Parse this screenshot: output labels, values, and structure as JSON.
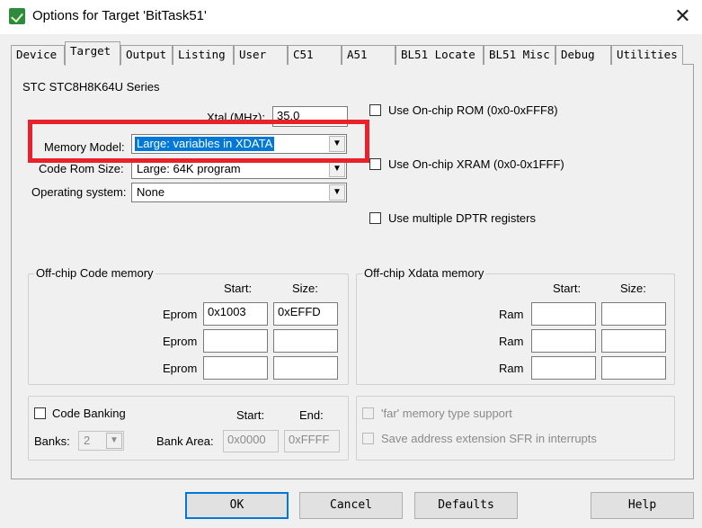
{
  "window": {
    "title": "Options for Target 'BitTask51'",
    "close_glyph": "✕"
  },
  "tabs": [
    {
      "label": "Device"
    },
    {
      "label": "Target"
    },
    {
      "label": "Output"
    },
    {
      "label": "Listing"
    },
    {
      "label": "User"
    },
    {
      "label": "C51"
    },
    {
      "label": "A51"
    },
    {
      "label": "BL51 Locate"
    },
    {
      "label": "BL51 Misc"
    },
    {
      "label": "Debug"
    },
    {
      "label": "Utilities"
    }
  ],
  "device_name": "STC STC8H8K64U Series",
  "xtal": {
    "label": "Xtal (MHz):",
    "value": "35.0"
  },
  "memory_model": {
    "label": "Memory Model:",
    "value": "Large: variables in XDATA"
  },
  "code_rom_size": {
    "label": "Code Rom Size:",
    "value": "Large: 64K program"
  },
  "operating_system": {
    "label": "Operating system:",
    "value": "None"
  },
  "options": {
    "onchip_rom": "Use On-chip ROM (0x0-0xFFF8)",
    "onchip_xram": "Use On-chip XRAM (0x0-0x1FFF)",
    "multiple_dptr": "Use multiple DPTR registers"
  },
  "offchip_code": {
    "title": "Off-chip Code memory",
    "start_header": "Start:",
    "size_header": "Size:",
    "rows": [
      {
        "label": "Eprom",
        "start": "0x1003",
        "size": "0xEFFD"
      },
      {
        "label": "Eprom",
        "start": "",
        "size": ""
      },
      {
        "label": "Eprom",
        "start": "",
        "size": ""
      }
    ]
  },
  "offchip_xdata": {
    "title": "Off-chip Xdata memory",
    "start_header": "Start:",
    "size_header": "Size:",
    "rows": [
      {
        "label": "Ram",
        "start": "",
        "size": ""
      },
      {
        "label": "Ram",
        "start": "",
        "size": ""
      },
      {
        "label": "Ram",
        "start": "",
        "size": ""
      }
    ]
  },
  "code_banking": {
    "label": "Code Banking",
    "start_header": "Start:",
    "end_header": "End:",
    "banks_label": "Banks:",
    "banks_value": "2",
    "bank_area_label": "Bank Area:",
    "bank_area_start": "0x0000",
    "bank_area_end": "0xFFFF"
  },
  "far_options": {
    "far_memory": "'far' memory type support",
    "save_sfr": "Save address extension SFR in interrupts"
  },
  "buttons": {
    "ok": "OK",
    "cancel": "Cancel",
    "defaults": "Defaults",
    "help": "Help"
  },
  "colors": {
    "highlight": "#e8222a",
    "selection": "#0078d7"
  }
}
